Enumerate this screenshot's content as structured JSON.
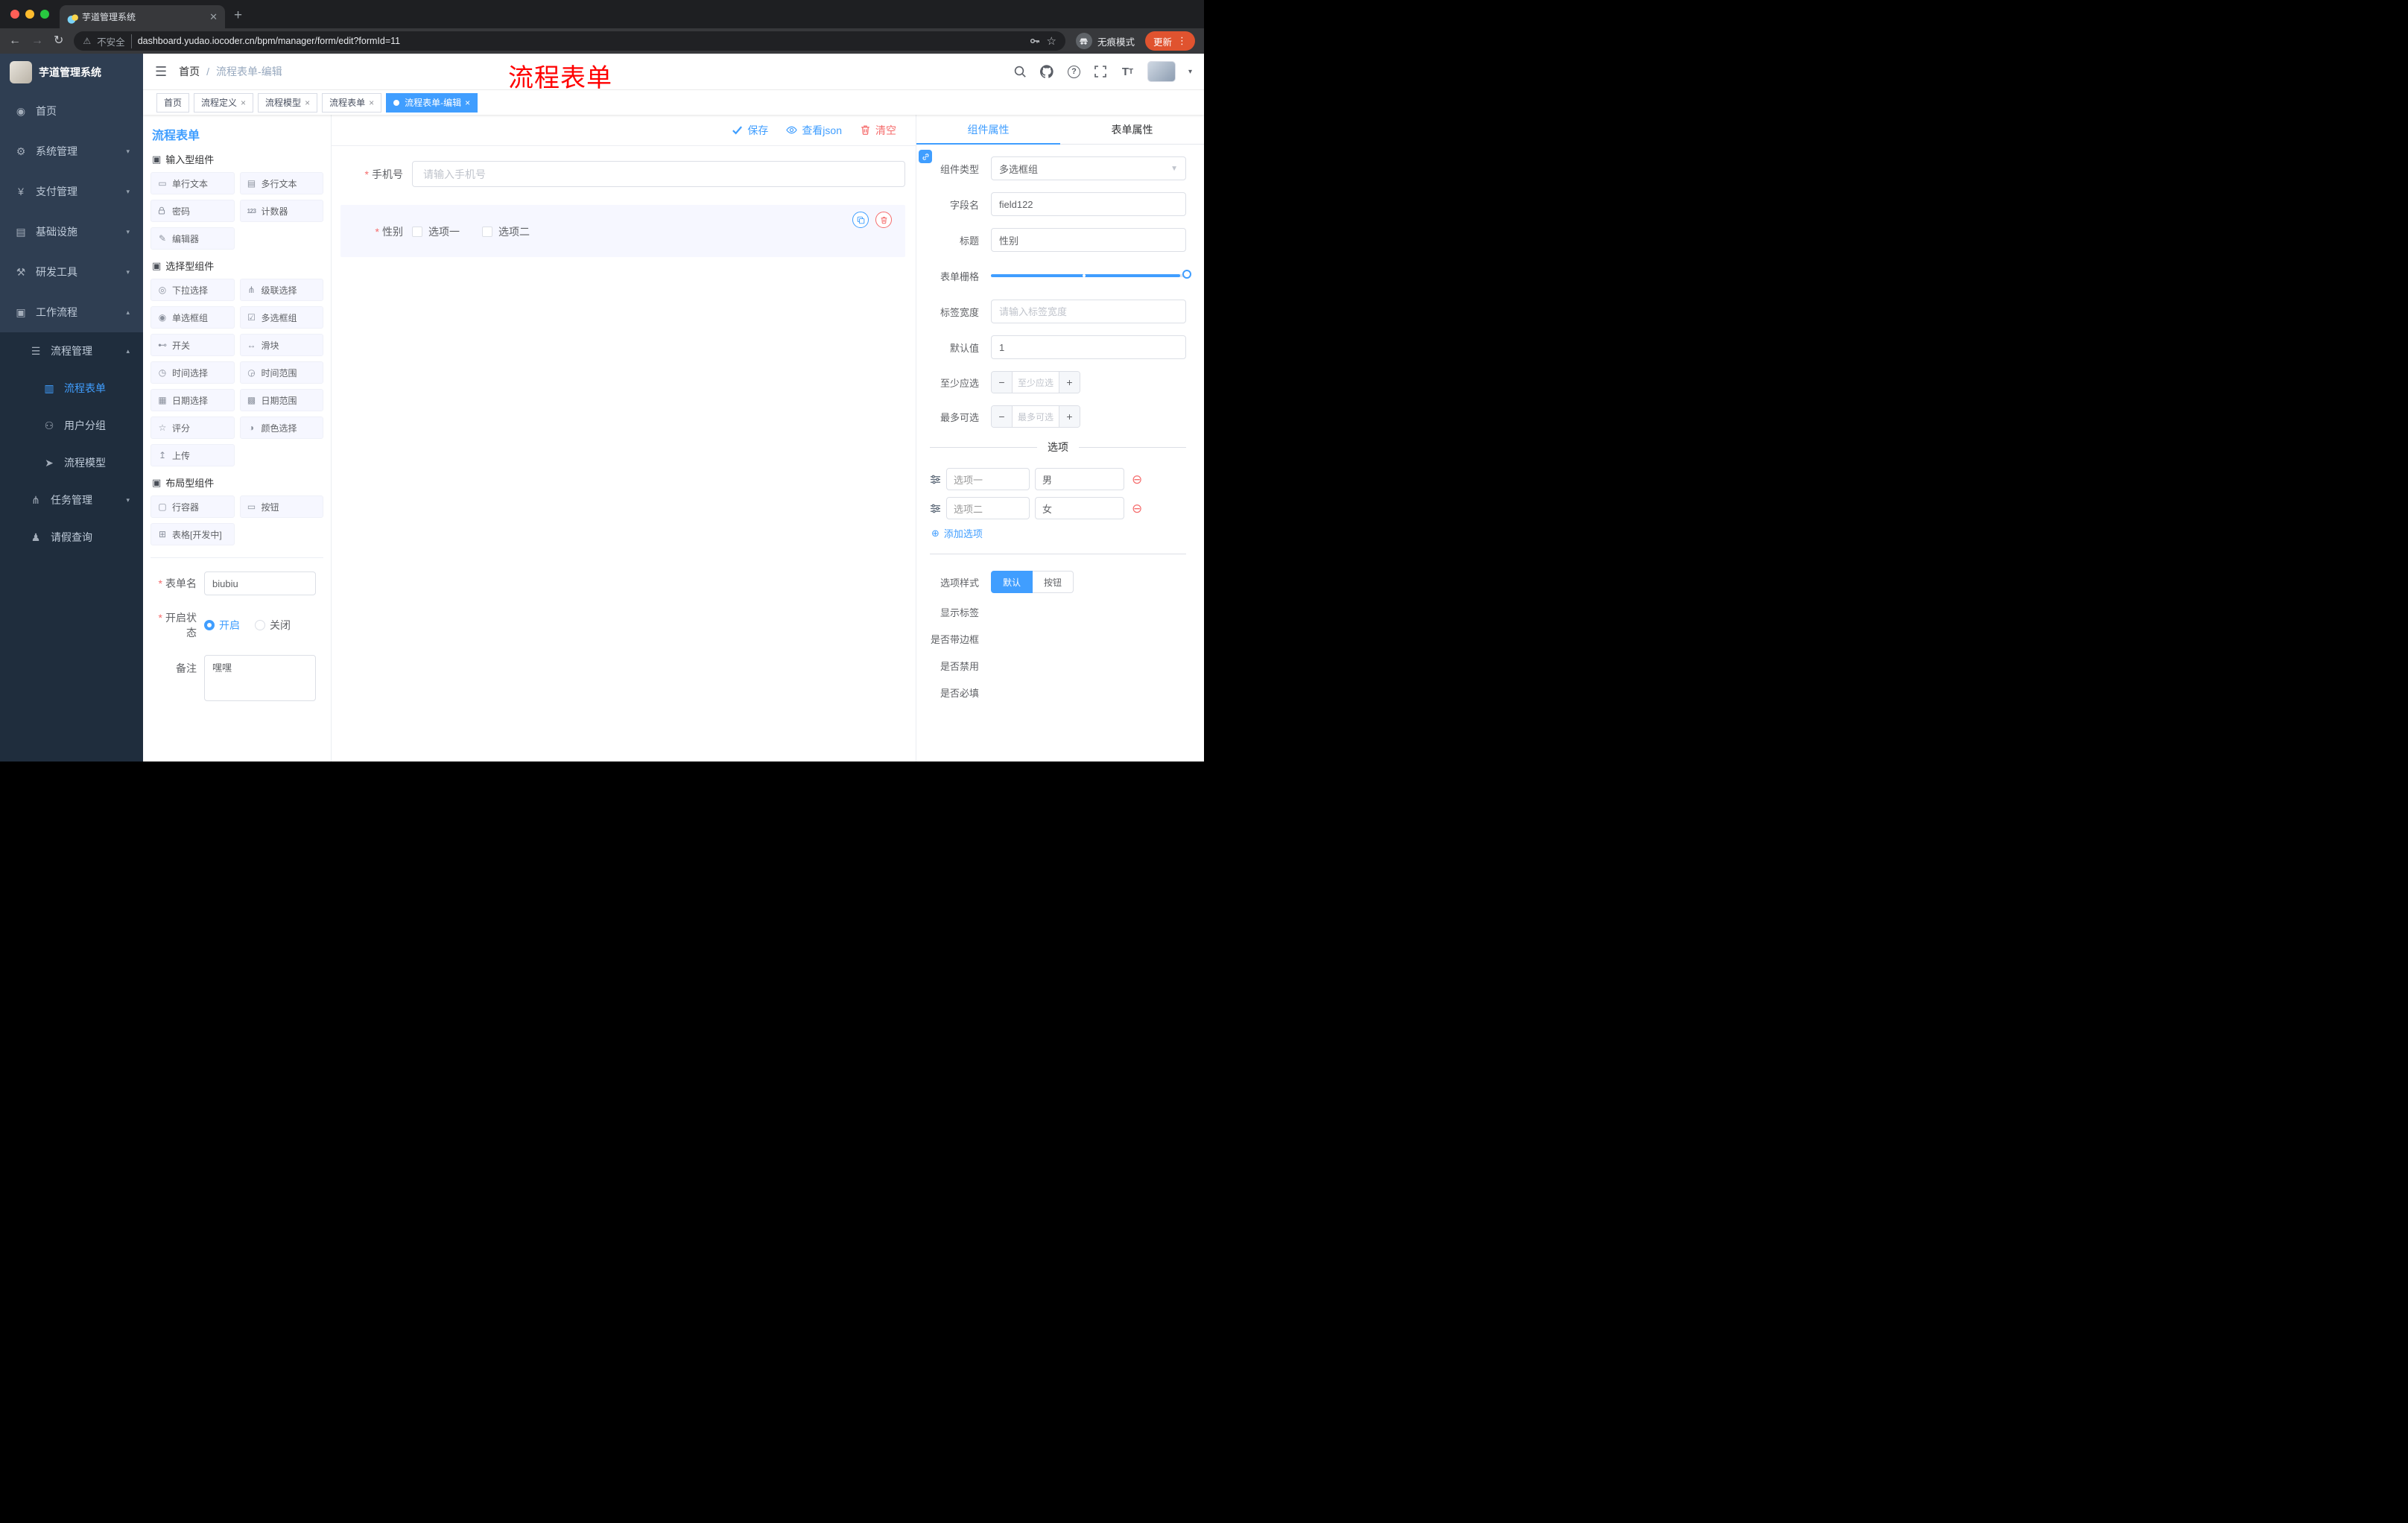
{
  "colors": {
    "primary": "#409EFF",
    "danger": "#F56C6C",
    "update_pill": "#E0532F",
    "sidebar_bg": "#2F3E52",
    "sidebar_sub_bg": "#1F2D3D"
  },
  "browser": {
    "tab_title": "芋道管理系统",
    "security_label": "不安全",
    "url": "dashboard.yudao.iocoder.cn/bpm/manager/form/edit?formId=11",
    "incognito_label": "无痕模式",
    "update_label": "更新"
  },
  "header": {
    "breadcrumb_home": "首页",
    "breadcrumb_current": "流程表单-编辑",
    "watermark": "流程表单"
  },
  "sidebar": {
    "title": "芋道管理系统",
    "menu": [
      {
        "label": "首页",
        "icon": "dashboard-icon"
      },
      {
        "label": "系统管理",
        "icon": "gear-icon"
      },
      {
        "label": "支付管理",
        "icon": "payment-icon"
      },
      {
        "label": "基础设施",
        "icon": "infrastructure-icon"
      },
      {
        "label": "研发工具",
        "icon": "devtools-icon"
      },
      {
        "label": "工作流程",
        "icon": "workflow-icon"
      },
      {
        "label": "流程管理",
        "icon": "process-management-icon"
      },
      {
        "label": "流程表单",
        "icon": "process-form-icon"
      },
      {
        "label": "用户分组",
        "icon": "user-group-icon"
      },
      {
        "label": "流程模型",
        "icon": "process-model-icon"
      },
      {
        "label": "任务管理",
        "icon": "task-management-icon"
      },
      {
        "label": "请假查询",
        "icon": "leave-query-icon"
      }
    ]
  },
  "tags_view": [
    {
      "label": "首页"
    },
    {
      "label": "流程定义"
    },
    {
      "label": "流程模型"
    },
    {
      "label": "流程表单"
    },
    {
      "label": "流程表单-编辑"
    }
  ],
  "palette": {
    "title": "流程表单",
    "groups": [
      {
        "title": "输入型组件",
        "items": [
          "单行文本",
          "多行文本",
          "密码",
          "计数器",
          "编辑器"
        ]
      },
      {
        "title": "选择型组件",
        "items": [
          "下拉选择",
          "级联选择",
          "单选框组",
          "多选框组",
          "开关",
          "滑块",
          "时间选择",
          "时间范围",
          "日期选择",
          "日期范围",
          "评分",
          "颜色选择",
          "上传"
        ]
      },
      {
        "title": "布局型组件",
        "items": [
          "行容器",
          "按钮",
          "表格[开发中]"
        ]
      }
    ]
  },
  "form_meta": {
    "name_label": "表单名",
    "name_value": "biubiu",
    "status_label": "开启状态",
    "status_on": "开启",
    "status_off": "关闭",
    "remark_label": "备注",
    "remark_value": "嘿嘿"
  },
  "canvas": {
    "save": "保存",
    "view_json": "查看json",
    "clear": "清空",
    "phone_label": "手机号",
    "phone_placeholder": "请输入手机号",
    "gender_label": "性别",
    "gender_options": [
      "选项一",
      "选项二"
    ]
  },
  "inspector": {
    "tab_component": "组件属性",
    "tab_form": "表单属性",
    "component_type_label": "组件类型",
    "component_type_value": "多选框组",
    "field_name_label": "字段名",
    "field_name_value": "field122",
    "title_label": "标题",
    "title_value": "性别",
    "grid_label": "表单栅格",
    "label_width_label": "标签宽度",
    "label_width_placeholder": "请输入标签宽度",
    "default_label": "默认值",
    "default_value": "1",
    "min_label": "至少应选",
    "min_placeholder": "至少应选",
    "max_label": "最多可选",
    "max_placeholder": "最多可选",
    "options_divider": "选项",
    "options": [
      {
        "label": "选项一",
        "value": "男"
      },
      {
        "label": "选项二",
        "value": "女"
      }
    ],
    "add_option": "添加选项",
    "style_label": "选项样式",
    "style_default": "默认",
    "style_button": "按钮",
    "switch_show_label": "显示标签",
    "switch_border": "是否带边框",
    "switch_disabled": "是否禁用",
    "switch_required": "是否必填"
  }
}
